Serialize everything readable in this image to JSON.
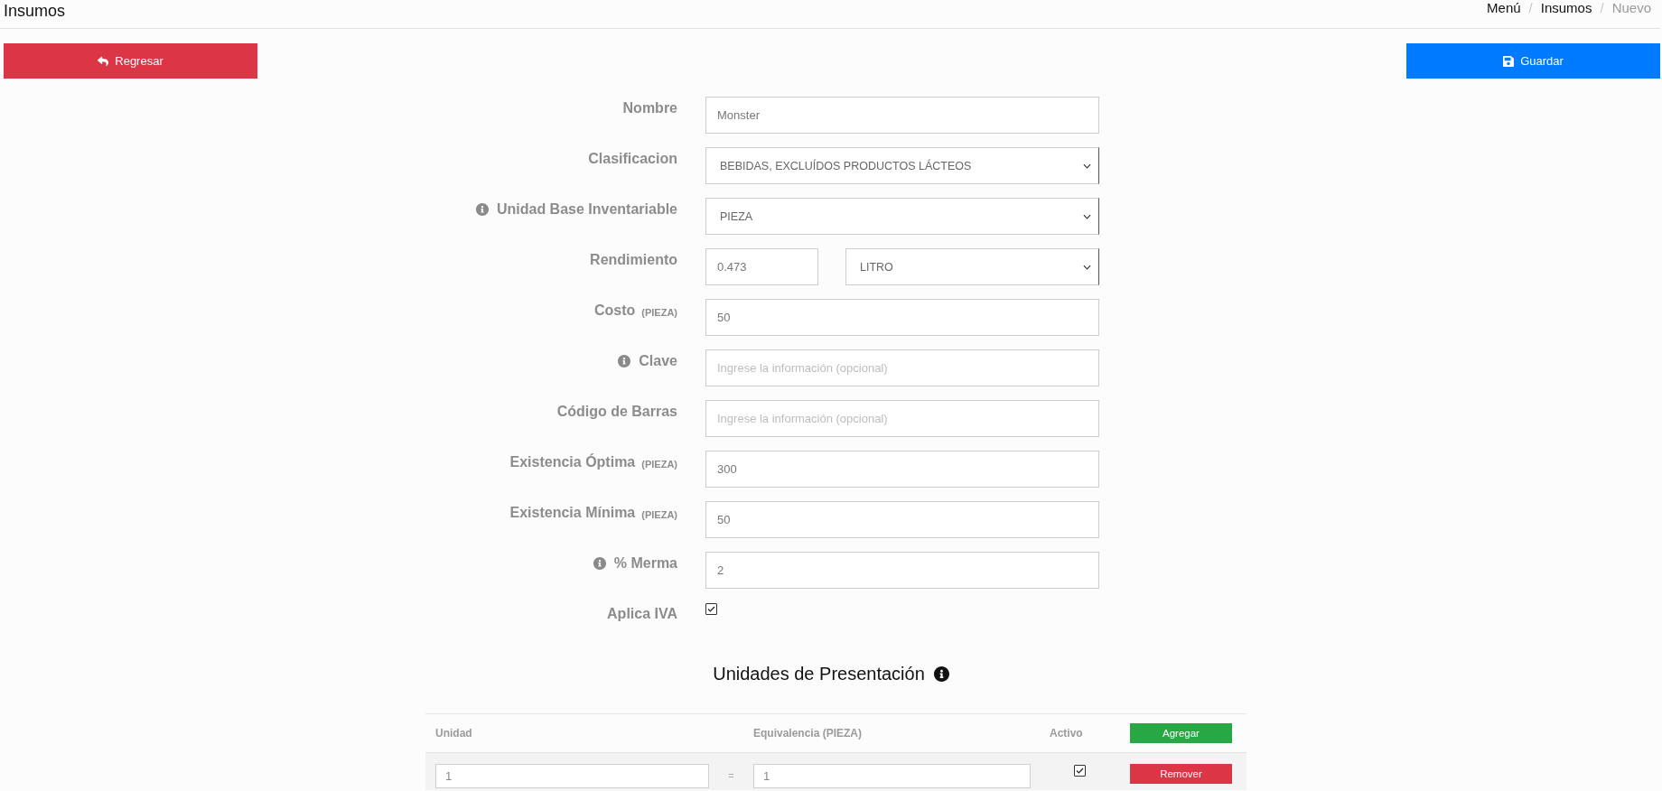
{
  "header": {
    "title": "Insumos",
    "breadcrumb": [
      {
        "kind": "link",
        "text": "Menú"
      },
      {
        "kind": "separator",
        "text": "/"
      },
      {
        "kind": "link",
        "text": "Insumos"
      },
      {
        "kind": "separator",
        "text": "/"
      },
      {
        "kind": "current",
        "text": "Nuevo"
      }
    ]
  },
  "actions": {
    "back": {
      "label": "Regresar"
    },
    "save": {
      "label": "Guardar"
    }
  },
  "form": {
    "fields": [
      {
        "kind": "text",
        "label": "Nombre",
        "info": false,
        "value": "Monster"
      },
      {
        "kind": "select",
        "label": "Clasificacion",
        "info": false,
        "value": "BEBIDAS, EXCLUÍDOS PRODUCTOS LÁCTEOS"
      },
      {
        "kind": "select",
        "label": "Unidad Base Inventariable",
        "info": true,
        "value": "PIEZA"
      },
      {
        "kind": "split",
        "label": "Rendimiento",
        "info": false,
        "value": "0.473",
        "unit_value": "LITRO"
      },
      {
        "kind": "text",
        "label": "Costo",
        "unit": "(PIEZA)",
        "info": false,
        "value": "50"
      },
      {
        "kind": "text",
        "label": "Clave",
        "info": true,
        "placeholder": "Ingrese la información (opcional)"
      },
      {
        "kind": "text",
        "label": "Código de Barras",
        "info": false,
        "placeholder": "Ingrese la información (opcional)"
      },
      {
        "kind": "text",
        "label": "Existencia Óptima",
        "unit": "(PIEZA)",
        "info": false,
        "value": "300"
      },
      {
        "kind": "text",
        "label": "Existencia Mínima",
        "unit": "(PIEZA)",
        "info": false,
        "value": "50"
      },
      {
        "kind": "text",
        "label": "% Merma",
        "info": true,
        "value": "2"
      },
      {
        "kind": "checkbox",
        "label": "Aplica IVA",
        "info": false,
        "checked": true
      }
    ]
  },
  "presentation": {
    "title": "Unidades de Presentación",
    "columns": [
      "Unidad",
      "Equivalencia (PIEZA)",
      "Activo"
    ],
    "add_button": "Agregar",
    "rows": [
      {
        "unit": "1",
        "separator": "=",
        "equivalence": "1",
        "active": true,
        "remove_button": "Remover"
      }
    ]
  }
}
